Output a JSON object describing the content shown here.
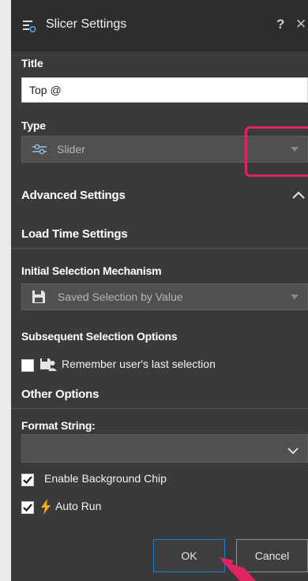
{
  "dialog": {
    "title": "Slicer Settings",
    "help_label": "?",
    "close_label": "✕"
  },
  "title_section": {
    "label": "Title",
    "value": "Top @"
  },
  "type_section": {
    "label": "Type",
    "selected": "Slider"
  },
  "advanced": {
    "heading": "Advanced Settings",
    "load_time_heading": "Load Time Settings",
    "initial_selection_label": "Initial Selection Mechanism",
    "initial_selection_value": "Saved Selection by Value",
    "subsequent_heading": "Subsequent Selection Options",
    "remember_label": "Remember user's last selection",
    "remember_checked": false
  },
  "other": {
    "heading": "Other Options",
    "format_label": "Format String:",
    "format_value": "",
    "enable_chip_label": "Enable Background Chip",
    "enable_chip_checked": true,
    "auto_run_label": "Auto Run",
    "auto_run_checked": true
  },
  "buttons": {
    "ok": "OK",
    "cancel": "Cancel"
  },
  "colors": {
    "annotation": "#e0245e",
    "accent": "#1e7bd6",
    "lightning": "#f5a623",
    "panel_bg": "#3a3a3a",
    "field_bg": "#505050"
  },
  "icons": {
    "header": "slicer-settings-icon",
    "type": "slider-icon",
    "initial_selection": "save-icon",
    "remember": "user-save-icon",
    "auto_run": "lightning-icon"
  }
}
